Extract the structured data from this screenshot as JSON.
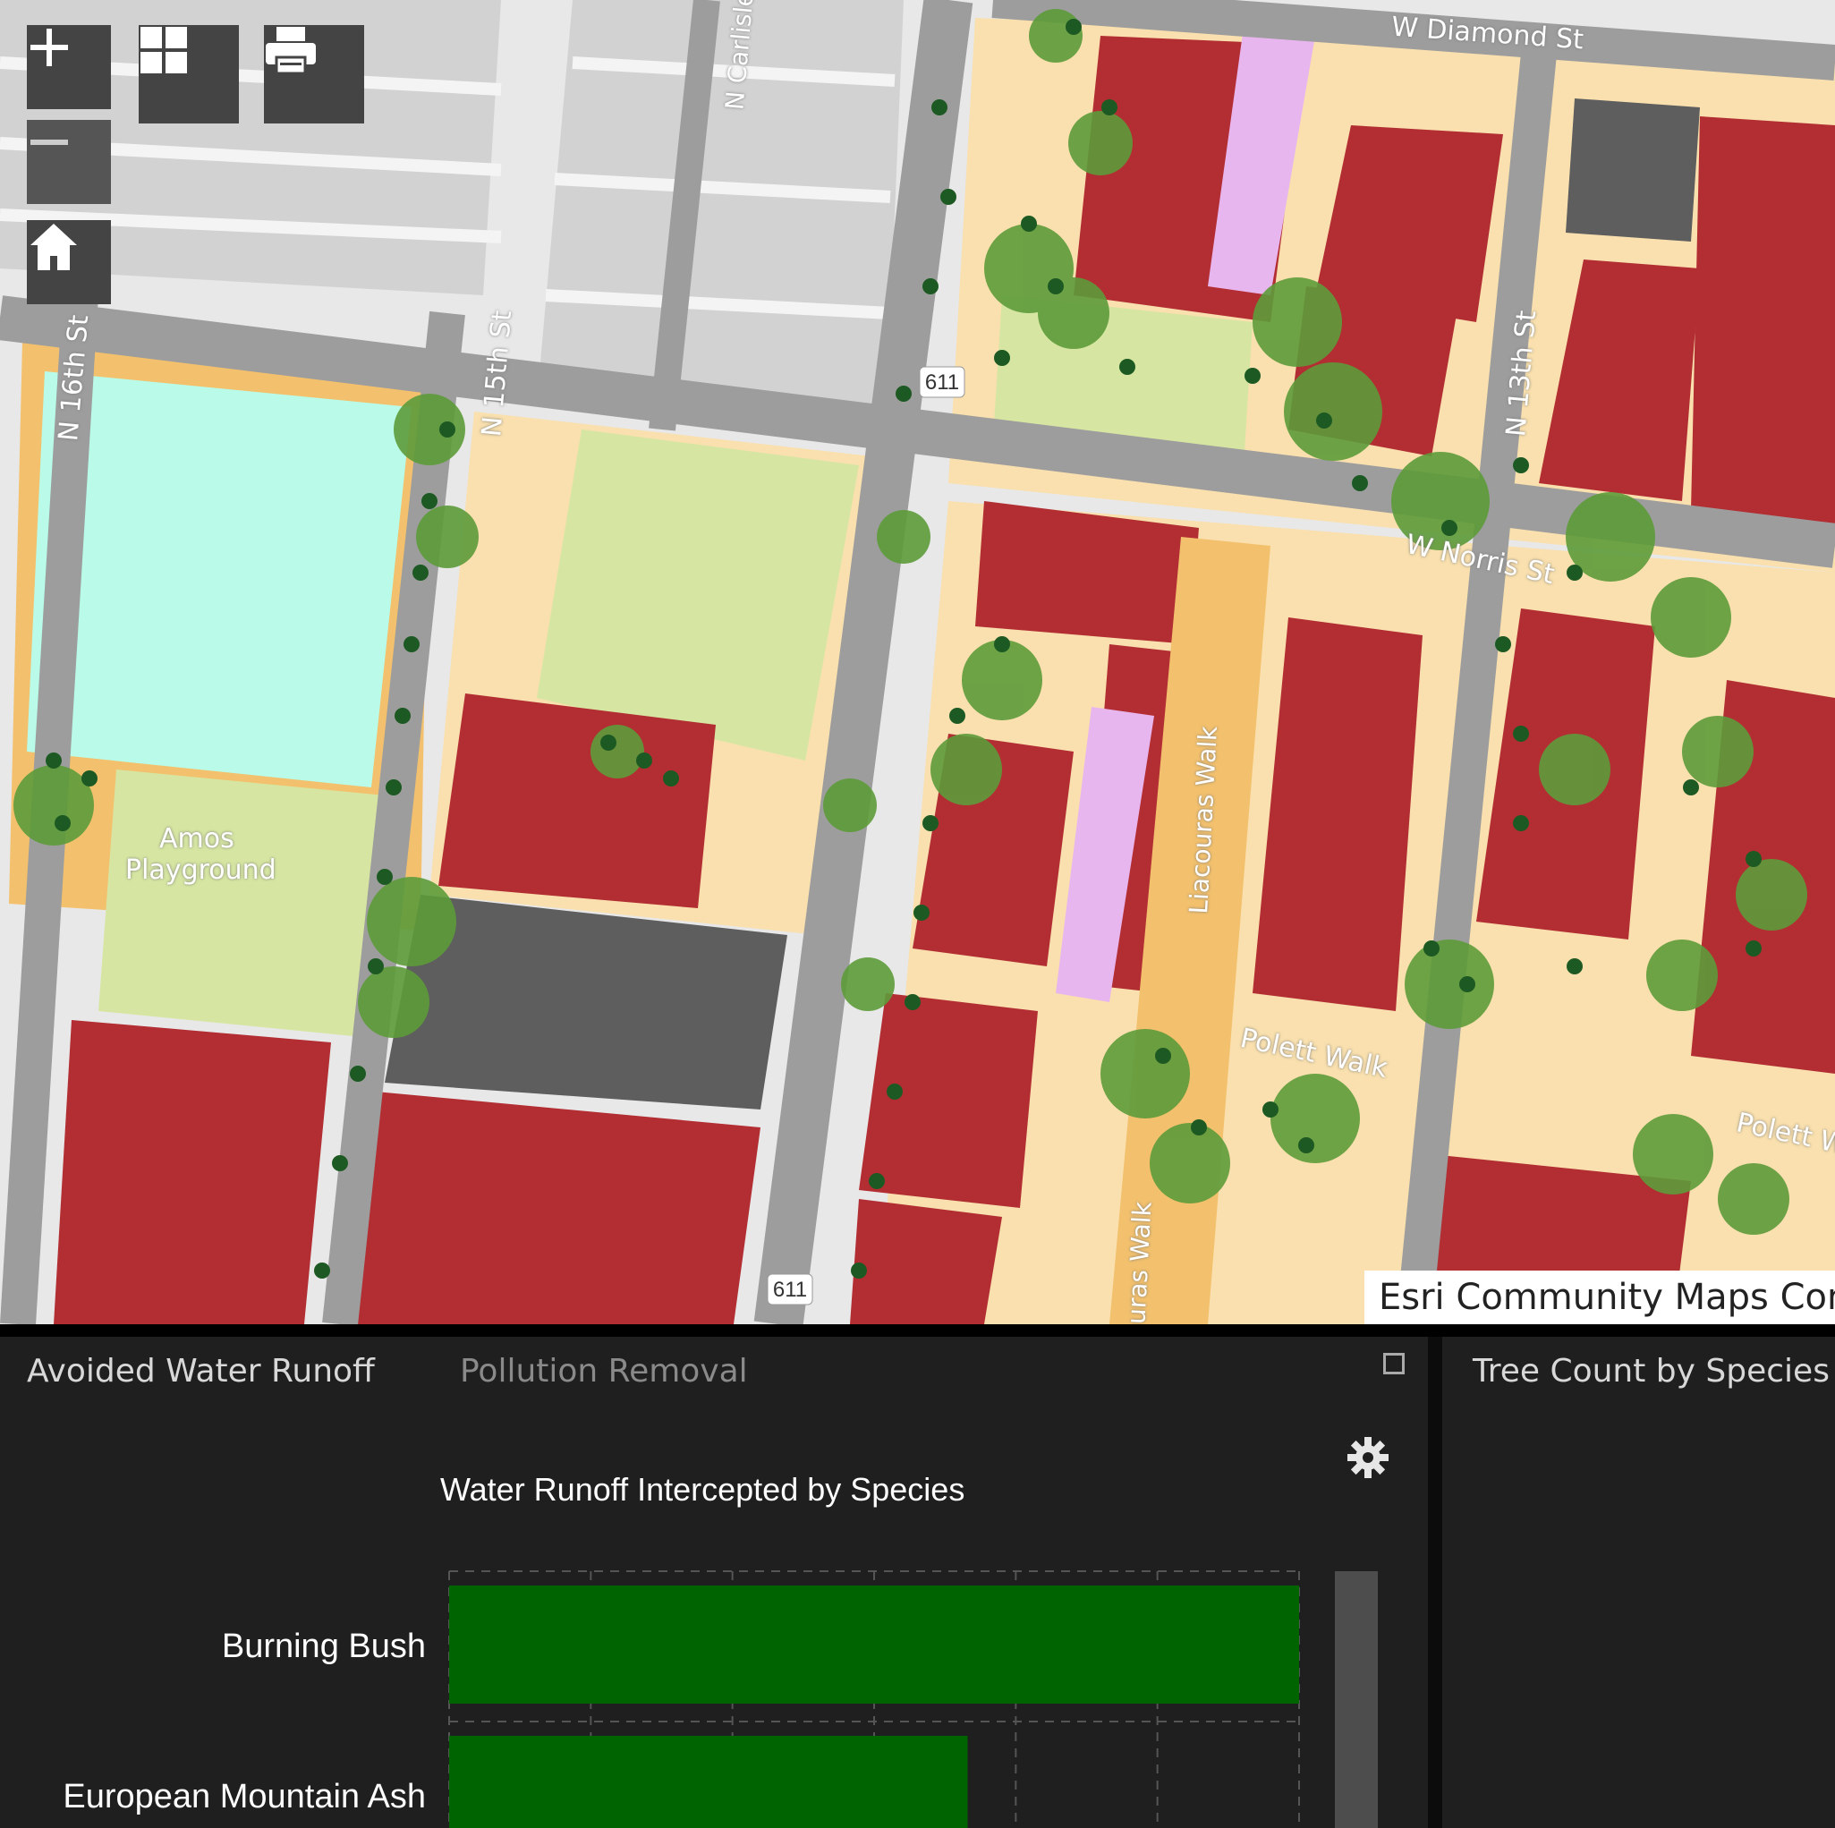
{
  "map": {
    "street_labels": [
      "W Diamond St",
      "N Carlisle",
      "N 16th St",
      "N 15th St",
      "N 13th St",
      "W Norris St",
      "Liacouras Walk",
      "Polett Walk",
      "Polett W",
      "uras Walk",
      "Amos",
      "Playground",
      "611",
      "611"
    ],
    "controls": [
      "zoom-in",
      "zoom-out",
      "home",
      "basemap-gallery",
      "print"
    ],
    "attribution": "Esri Community Maps Cont"
  },
  "tabs": {
    "active": "Avoided Water Runoff",
    "inactive": "Pollution Removal",
    "right": "Tree Count by Species"
  },
  "chart_data": {
    "type": "bar",
    "orientation": "horizontal",
    "title": "Water Runoff Intercepted by Species",
    "categories": [
      "Burning Bush",
      "European Mountain Ash"
    ],
    "values": [
      1.0,
      0.61
    ],
    "value_note_unit": "fraction of largest bar",
    "bar_color": "#006400",
    "grid": true
  },
  "colors": {
    "building": "#b22e33",
    "park": "#d6e6a2",
    "sidewalk": "#f3c16d",
    "road": "#9d9d9d",
    "tree": "#4d8c2f",
    "panel_bg": "#1f1f1f"
  }
}
